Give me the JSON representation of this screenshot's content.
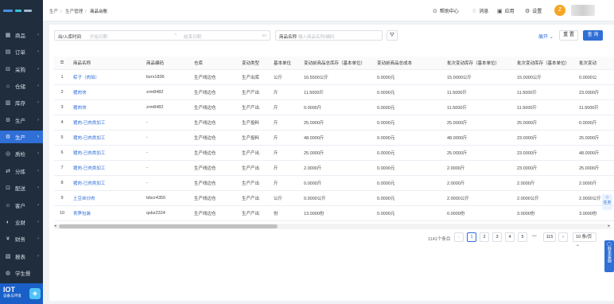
{
  "sidebar": {
    "items": [
      {
        "label": "商品",
        "icon": "grid-icon"
      },
      {
        "label": "订单",
        "icon": "order-icon"
      },
      {
        "label": "采购",
        "icon": "cart-icon"
      },
      {
        "label": "仓储",
        "icon": "warehouse-icon"
      },
      {
        "label": "库存",
        "icon": "inventory-icon"
      },
      {
        "label": "生产",
        "icon": "production-icon"
      },
      {
        "label": "生产",
        "icon": "production-icon"
      },
      {
        "label": "质检",
        "icon": "inspect-icon"
      },
      {
        "label": "分拣",
        "icon": "sort-icon"
      },
      {
        "label": "配送",
        "icon": "truck-icon"
      },
      {
        "label": "客户",
        "icon": "customer-icon"
      },
      {
        "label": "业财",
        "icon": "finance-icon"
      },
      {
        "label": "财务",
        "icon": "money-icon"
      },
      {
        "label": "报表",
        "icon": "report-icon"
      },
      {
        "label": "学生餐",
        "icon": "meal-icon"
      }
    ],
    "iot": {
      "title": "IOT",
      "subtitle": "设备与环境"
    }
  },
  "header": {
    "breadcrumb": [
      "生产",
      "生产管理",
      "商品台账"
    ],
    "help": "帮助中心",
    "messages": "消息",
    "apps": "应用",
    "settings": "设置",
    "avatar_initial": "Z"
  },
  "filters": {
    "date_label": "出/入库时间",
    "date_start_placeholder": "开始日期",
    "date_end_placeholder": "结束日期",
    "name_label": "商品名称",
    "name_placeholder": "输入商品名称/编码",
    "expand": "展开",
    "reset": "重 置",
    "query": "查 询"
  },
  "table": {
    "columns": [
      "",
      "商品名称",
      "商品编码",
      "仓库",
      "变动类型",
      "基本单位",
      "变动前商品总库存（基本单位）",
      "变动前商品总成本",
      "批次变动库存（基本单位）",
      "批次变动库存（基本单位）",
      "批次变动"
    ],
    "rows": [
      [
        "1",
        "粽子（肉馅）",
        "bzrx1836",
        "生产线边仓",
        "生产出库",
        "公斤",
        "16.5500公斤",
        "0.0000元",
        "15.0000公斤",
        "15.0000公斤",
        "0.0000公"
      ],
      [
        "2",
        "猪肉块",
        "zrm8482",
        "生产线边仓",
        "生产产出",
        "斤",
        "11.5000斤",
        "0.0000元",
        "11.5000斤",
        "11.5000斤",
        "23.0000斤"
      ],
      [
        "3",
        "猪肉块",
        "zrm8482",
        "生产线边仓",
        "生产产出",
        "斤",
        "0.0000斤",
        "0.0000元",
        "11.5000斤",
        "11.5000斤",
        "11.5000斤"
      ],
      [
        "4",
        "猪肉-已肉类加工",
        "-",
        "生产线边仓",
        "生产投料",
        "斤",
        "25.0000斤",
        "0.0000元",
        "25.0000斤",
        "25.0000斤",
        "0.0000斤"
      ],
      [
        "5",
        "猪肉-已肉类加工",
        "-",
        "生产线边仓",
        "生产投料",
        "斤",
        "48.0000斤",
        "0.0000元",
        "48.0000斤",
        "23.0000斤",
        "25.0000斤"
      ],
      [
        "6",
        "猪肉-已肉类加工",
        "-",
        "生产线边仓",
        "生产产出",
        "斤",
        "25.0000斤",
        "0.0000元",
        "25.0000斤",
        "23.0000斤",
        "48.0000斤"
      ],
      [
        "7",
        "猪肉-已肉类加工",
        "-",
        "生产线边仓",
        "生产产出",
        "斤",
        "2.0000斤",
        "0.0000元",
        "2.0000斤",
        "23.0000斤",
        "25.0000斤"
      ],
      [
        "8",
        "猪肉-已肉类加工",
        "-",
        "生产线边仓",
        "生产产出",
        "斤",
        "0.0000斤",
        "0.0000元",
        "2.0000斤",
        "2.0000斤",
        "2.0000斤"
      ],
      [
        "9",
        "土豆丝炒肉",
        "tdscr4355",
        "生产线边仓",
        "生产产出",
        "公斤",
        "0.0000公斤",
        "0.0000元",
        "2.0000公斤",
        "2.0000公斤",
        "2.0000公斤"
      ],
      [
        "10",
        "青笋包装",
        "qsbz2324",
        "生产线边仓",
        "生产产出",
        "份",
        "13.0000份",
        "0.0000元",
        "0.0000份",
        "3.0000份",
        "3.0000份"
      ]
    ]
  },
  "pagination": {
    "total": "1141个条目",
    "pages": [
      "1",
      "2",
      "3",
      "4",
      "5"
    ],
    "dots": "•••",
    "last": "115",
    "size": "10 条/页",
    "prev": "‹",
    "next": "›"
  },
  "floaters": {
    "task": "任务",
    "service": "联系客服"
  },
  "colors": {
    "primary": "#2f6fd6",
    "sidebar": "#1f2d3d"
  }
}
